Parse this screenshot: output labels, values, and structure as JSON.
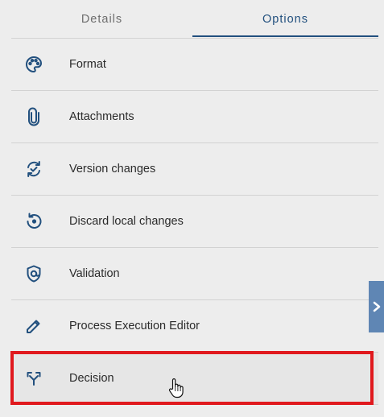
{
  "tabs": {
    "details_label": "Details",
    "options_label": "Options",
    "active": "Options"
  },
  "options": [
    {
      "label": "Format",
      "icon": "palette-icon"
    },
    {
      "label": "Attachments",
      "icon": "paperclip-icon"
    },
    {
      "label": "Version changes",
      "icon": "version-sync-icon"
    },
    {
      "label": "Discard local changes",
      "icon": "restore-icon"
    },
    {
      "label": "Validation",
      "icon": "shield-check-icon"
    },
    {
      "label": "Process Execution Editor",
      "icon": "pencil-icon"
    },
    {
      "label": "Decision",
      "icon": "merge-arrows-icon"
    }
  ],
  "highlighted_option": "Decision",
  "colors": {
    "accent": "#22507e",
    "highlight_border": "#e0191e",
    "side_tab": "#5f86b4",
    "background": "#ededed"
  }
}
